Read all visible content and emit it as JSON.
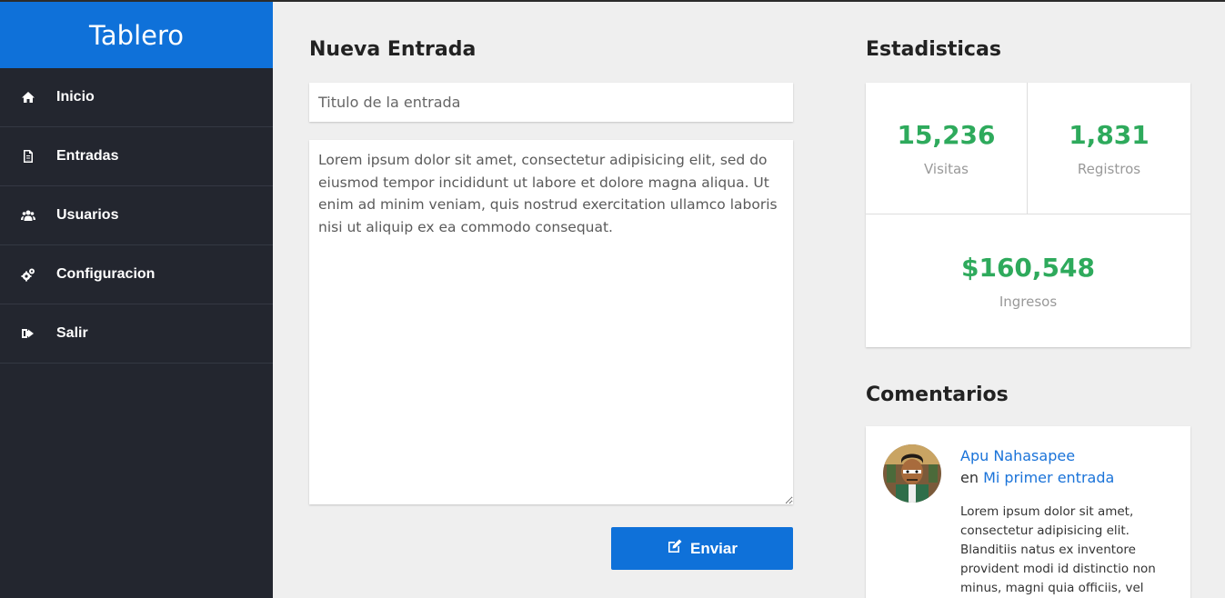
{
  "sidebar": {
    "brand": "Tablero",
    "items": [
      {
        "label": "Inicio",
        "icon": "home-icon"
      },
      {
        "label": "Entradas",
        "icon": "document-icon"
      },
      {
        "label": "Usuarios",
        "icon": "users-icon"
      },
      {
        "label": "Configuracion",
        "icon": "cogs-icon"
      },
      {
        "label": "Salir",
        "icon": "sign-out-icon"
      }
    ]
  },
  "new_entry": {
    "heading": "Nueva Entrada",
    "title_placeholder": "Titulo de la entrada",
    "body_value": "Lorem ipsum dolor sit amet, consectetur adipisicing elit, sed do eiusmod tempor incididunt ut labore et dolore magna aliqua. Ut enim ad minim veniam, quis nostrud exercitation ullamco laboris nisi ut aliquip ex ea commodo consequat.",
    "submit_label": "Enviar"
  },
  "stats": {
    "heading": "Estadisticas",
    "visits_value": "15,236",
    "visits_label": "Visitas",
    "registrations_value": "1,831",
    "registrations_label": "Registros",
    "income_value": "$160,548",
    "income_label": "Ingresos"
  },
  "comments": {
    "heading": "Comentarios",
    "items": [
      {
        "author": "Apu Nahasapee",
        "prefix": "en",
        "entry": "Mi primer entrada",
        "text": "Lorem ipsum dolor sit amet, consectetur adipisicing elit. Blanditiis natus ex inventore provident modi id distinctio non minus, magni quia officiis, vel"
      }
    ]
  },
  "colors": {
    "brand_blue": "#0f71d9",
    "sidebar_bg": "#23262f",
    "stat_green": "#2eaa5c",
    "link_blue": "#1a73d9"
  }
}
